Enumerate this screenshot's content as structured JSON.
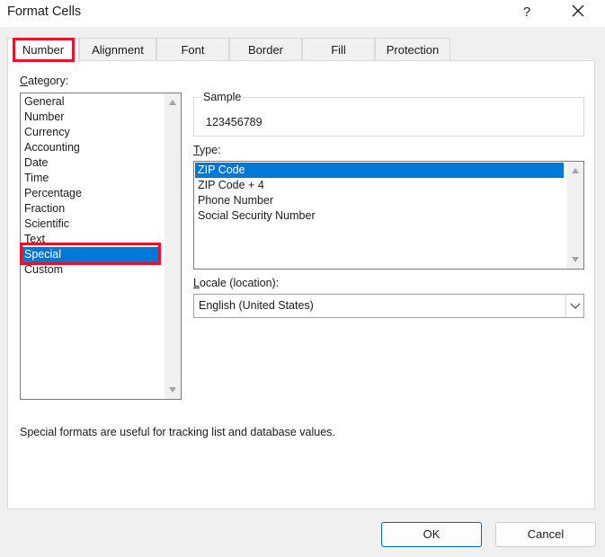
{
  "window": {
    "title": "Format Cells",
    "help_label": "?",
    "close_icon": "close-icon"
  },
  "tabs": [
    {
      "label": "Number",
      "active": true
    },
    {
      "label": "Alignment"
    },
    {
      "label": "Font"
    },
    {
      "label": "Border"
    },
    {
      "label": "Fill"
    },
    {
      "label": "Protection"
    }
  ],
  "category": {
    "label_underlined": "C",
    "label_rest": "ategory:",
    "items": [
      "General",
      "Number",
      "Currency",
      "Accounting",
      "Date",
      "Time",
      "Percentage",
      "Fraction",
      "Scientific",
      "Text",
      "Special",
      "Custom"
    ],
    "selected": "Special"
  },
  "sample": {
    "label": "Sample",
    "value": "123456789"
  },
  "type": {
    "label_underlined": "T",
    "label_rest": "ype:",
    "items": [
      "ZIP Code",
      "ZIP Code + 4",
      "Phone Number",
      "Social Security Number"
    ],
    "selected": "ZIP Code"
  },
  "locale": {
    "label_underlined": "L",
    "label_rest": "ocale (location):",
    "value": "English (United States)"
  },
  "description": "Special formats are useful for tracking list and database values.",
  "buttons": {
    "ok": "OK",
    "cancel": "Cancel"
  },
  "colors": {
    "selection": "#0078d7",
    "highlight": "#e8122b",
    "default_button_border": "#0067c0"
  }
}
